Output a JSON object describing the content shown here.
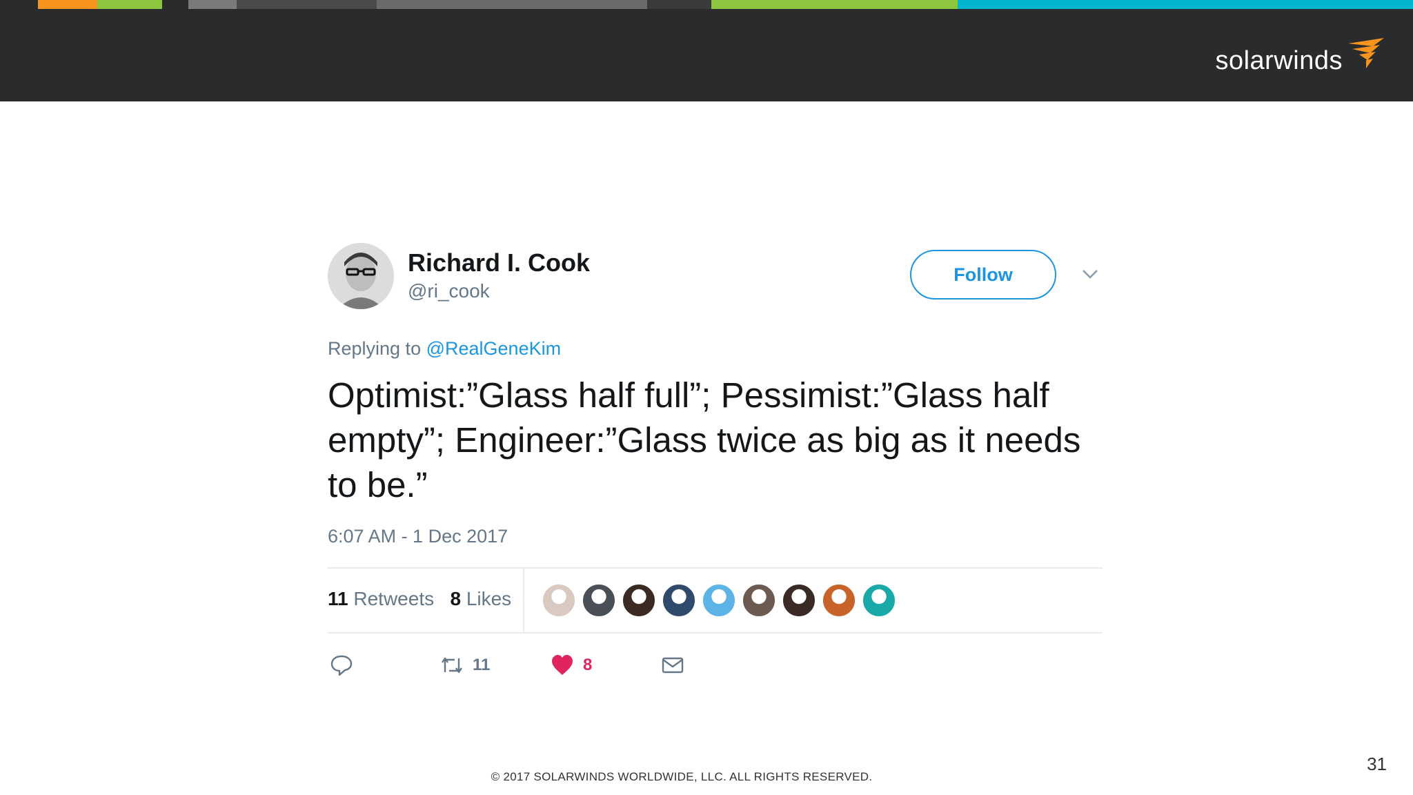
{
  "slide": {
    "strip_colors": [
      "#2a2b2d",
      "#f7941d",
      "#8cc63f",
      "#2a2b2d",
      "#7a7b7d",
      "#4a4b4d",
      "#6a6b6d",
      "#3a3b3d",
      "#8cc63f",
      "#00b5cc"
    ],
    "logo_text": "solarwinds",
    "logo_icon": "solarwinds-logo-icon",
    "brand_color": "#f7941d",
    "footer": "© 2017 SOLARWINDS WORLDWIDE, LLC. ALL RIGHTS RESERVED.",
    "page_number": "31"
  },
  "tweet": {
    "author_name": "Richard I. Cook",
    "author_handle": "@ri_cook",
    "follow_label": "Follow",
    "replying_prefix": "Replying to ",
    "replying_to": "@RealGeneKim",
    "text": "Optimist:”Glass half full”; Pessimist:”Glass half empty”; Engineer:”Glass twice as big as it needs to be.”",
    "timestamp": "6:07 AM - 1 Dec 2017",
    "retweets_count": "11",
    "retweets_label": "Retweets",
    "likes_count": "8",
    "likes_label": "Likes",
    "action_retweet_count": "11",
    "action_like_count": "8",
    "link_color": "#1b95e0",
    "like_color": "#e0245e",
    "liker_avatar_colors": [
      "#d9c9c0",
      "#4a4f57",
      "#3b2a22",
      "#2f4a6a",
      "#5bb4e5",
      "#6b5a50",
      "#3a2a25",
      "#c8642a",
      "#1aa9a9"
    ]
  }
}
